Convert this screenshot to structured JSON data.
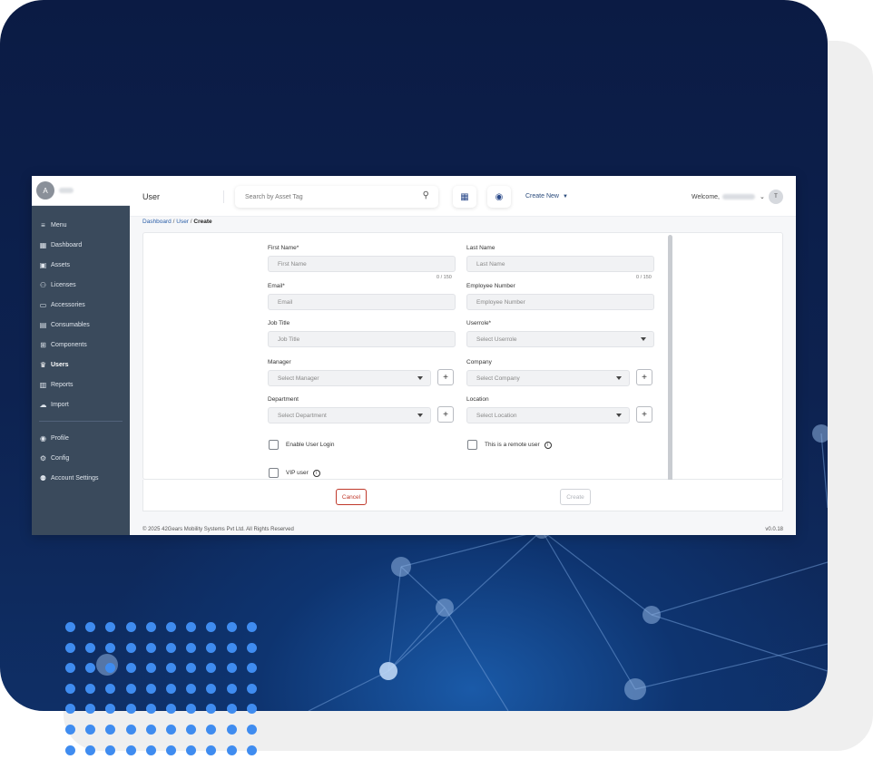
{
  "sidebar": {
    "avatar_initial": "A",
    "items": [
      {
        "label": "Menu",
        "icon": "menu-icon",
        "glyph": "≡"
      },
      {
        "label": "Dashboard",
        "icon": "dashboard-icon",
        "glyph": "▦"
      },
      {
        "label": "Assets",
        "icon": "assets-icon",
        "glyph": "▣"
      },
      {
        "label": "Licenses",
        "icon": "licenses-icon",
        "glyph": "⚇"
      },
      {
        "label": "Accessories",
        "icon": "accessories-icon",
        "glyph": "▭"
      },
      {
        "label": "Consumables",
        "icon": "consumables-icon",
        "glyph": "▤"
      },
      {
        "label": "Components",
        "icon": "components-icon",
        "glyph": "⊞"
      },
      {
        "label": "Users",
        "icon": "users-icon",
        "glyph": "♛",
        "active": true
      },
      {
        "label": "Reports",
        "icon": "reports-icon",
        "glyph": "▥"
      },
      {
        "label": "Import",
        "icon": "import-icon",
        "glyph": "☁"
      }
    ],
    "bottom_items": [
      {
        "label": "Profile",
        "icon": "profile-icon",
        "glyph": "◉"
      },
      {
        "label": "Config",
        "icon": "config-icon",
        "glyph": "⚙"
      },
      {
        "label": "Account Settings",
        "icon": "account-settings-icon",
        "glyph": "⚉"
      }
    ]
  },
  "header": {
    "title": "User",
    "search_placeholder": "Search by Asset Tag",
    "create_new": "Create New",
    "welcome": "Welcome,",
    "user_initial": "T"
  },
  "breadcrumb": {
    "dashboard": "Dashboard",
    "user": "User",
    "current": "Create",
    "sep": "/"
  },
  "form": {
    "first_name": {
      "label": "First Name*",
      "placeholder": "First Name",
      "counter": "0 / 150"
    },
    "last_name": {
      "label": "Last Name",
      "placeholder": "Last Name",
      "counter": "0 / 150"
    },
    "email": {
      "label": "Email*",
      "placeholder": "Email"
    },
    "employee_number": {
      "label": "Employee Number",
      "placeholder": "Employee Number"
    },
    "job_title": {
      "label": "Job Title",
      "placeholder": "Job Title"
    },
    "userrole": {
      "label": "Userrole*",
      "placeholder": "Select Userrole"
    },
    "manager": {
      "label": "Manager",
      "placeholder": "Select Manager"
    },
    "company": {
      "label": "Company",
      "placeholder": "Select Company"
    },
    "department": {
      "label": "Department",
      "placeholder": "Select Department"
    },
    "location": {
      "label": "Location",
      "placeholder": "Select Location"
    },
    "enable_login": "Enable User Login",
    "remote_user": "This is a remote user",
    "vip_user": "VIP user",
    "info_glyph": "i",
    "plus_glyph": "+"
  },
  "actions": {
    "cancel": "Cancel",
    "create": "Create"
  },
  "footer": {
    "copyright": "© 2025 42Gears Mobility Systems Pvt Ltd. All Rights Reserved",
    "version": "v0.0.18"
  },
  "colors": {
    "sidebar_bg": "#3a4a5c",
    "accent": "#2b5fa8",
    "cancel": "#c0392b",
    "background_dark": "#0b1b44"
  }
}
